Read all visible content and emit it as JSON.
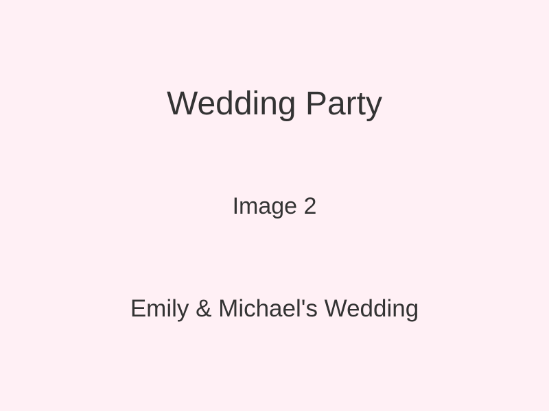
{
  "page": {
    "title": "Wedding Party",
    "image_label": "Image 2",
    "caption": "Emily & Michael's Wedding"
  },
  "colors": {
    "background": "#fff0f5",
    "text": "#333333"
  }
}
